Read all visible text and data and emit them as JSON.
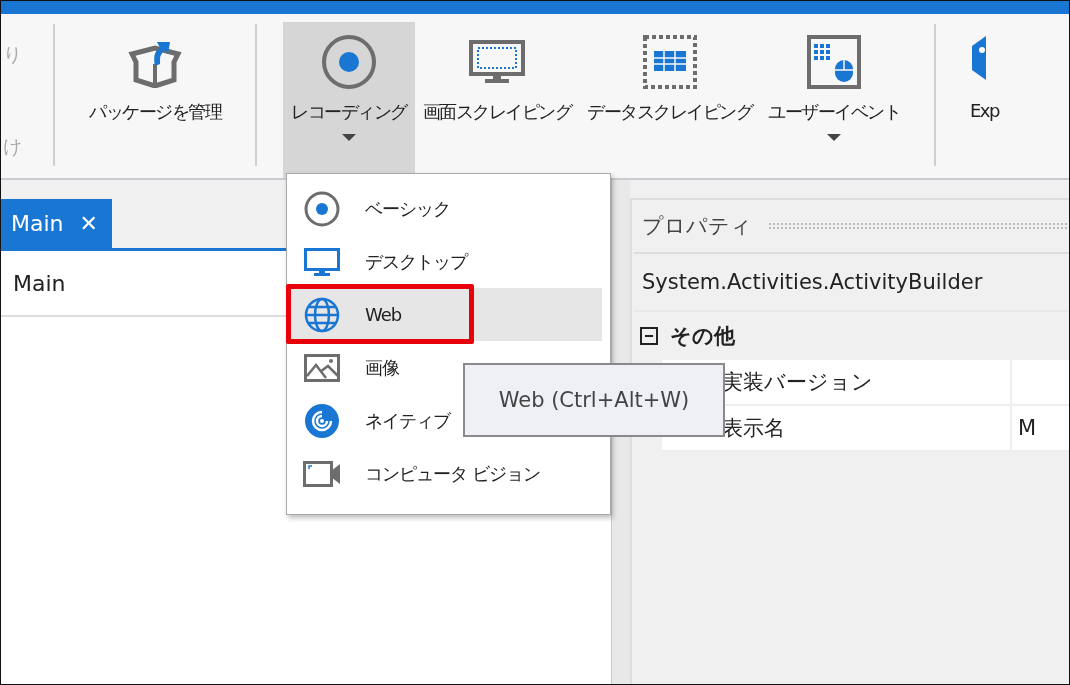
{
  "ribbon": {
    "partial_group": [
      {
        "label": "り",
        "disabled": true
      },
      {
        "label": "け",
        "disabled": true
      }
    ],
    "groups": [
      {
        "buttons": [
          {
            "kind": "package",
            "label": "パッケージを管理",
            "selected": false,
            "dropdown": false
          }
        ]
      },
      {
        "buttons": [
          {
            "kind": "record",
            "label": "レコーディング",
            "selected": true,
            "dropdown": true
          },
          {
            "kind": "screen",
            "label": "画面スクレイピング",
            "selected": false,
            "dropdown": false
          },
          {
            "kind": "data",
            "label": "データスクレイピング",
            "selected": false,
            "dropdown": false
          },
          {
            "kind": "user-event",
            "label": "ユーザーイベント",
            "selected": false,
            "dropdown": true
          }
        ]
      },
      {
        "buttons": [
          {
            "kind": "export",
            "label": "Exp",
            "selected": false,
            "dropdown": false
          }
        ]
      }
    ]
  },
  "designer": {
    "tabs": [
      {
        "label": "Main",
        "close": "✕",
        "selected": true
      }
    ],
    "breadcrumb": "Main"
  },
  "recording_menu": {
    "items": [
      {
        "kind": "basic",
        "label": "ベーシック",
        "selected": false,
        "outlined": false
      },
      {
        "kind": "desktop",
        "label": "デスクトップ",
        "selected": false,
        "outlined": false
      },
      {
        "kind": "web",
        "label": "Web",
        "selected": true,
        "outlined": true
      },
      {
        "kind": "image",
        "label": "画像",
        "selected": false,
        "outlined": false
      },
      {
        "kind": "native",
        "label": "ネイティブ",
        "selected": false,
        "outlined": false
      },
      {
        "kind": "cv",
        "label": "コンピュータ ビジョン",
        "selected": false,
        "outlined": false
      }
    ],
    "tooltip": "Web (Ctrl+Alt+W)"
  },
  "properties": {
    "title": "プロパティ",
    "object": "System.Activities.ActivityBuilder",
    "categories": [
      {
        "name": "その他",
        "expanded": true,
        "rows": [
          {
            "name": "実装バージョン"
          },
          {
            "name": "表示名",
            "value": "M"
          }
        ]
      }
    ]
  }
}
